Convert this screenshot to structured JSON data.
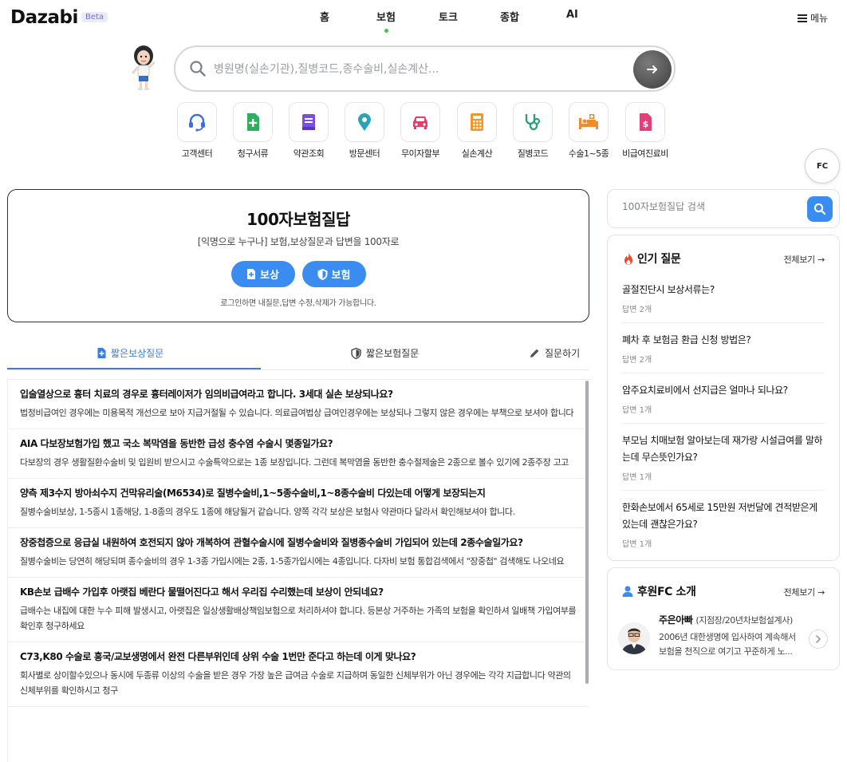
{
  "header": {
    "logo": "Dazabi",
    "badge": "Beta",
    "nav": [
      "홈",
      "보험",
      "토크",
      "종합",
      "AI"
    ],
    "active_nav": "보험",
    "menu_label": "메뉴"
  },
  "search": {
    "placeholder": "병원명(실손기관),질병코드,종수술비,실손계산..."
  },
  "quick_links": [
    {
      "label": "고객센터",
      "icon": "headset-icon",
      "color": "#3d6fe0"
    },
    {
      "label": "청구서류",
      "icon": "document-plus-icon",
      "color": "#2fae5e"
    },
    {
      "label": "약관조회",
      "icon": "book-icon",
      "color": "#7a4fe0"
    },
    {
      "label": "방문센터",
      "icon": "location-pin-icon",
      "color": "#2aa3b8"
    },
    {
      "label": "무이자할부",
      "icon": "car-icon",
      "color": "#e0406a"
    },
    {
      "label": "실손계산",
      "icon": "calculator-icon",
      "color": "#f0962a"
    },
    {
      "label": "질병코드",
      "icon": "stethoscope-icon",
      "color": "#2f9e7a"
    },
    {
      "label": "수술1~5종",
      "icon": "hospital-bed-icon",
      "color": "#f08a2a"
    },
    {
      "label": "비급여진료비",
      "icon": "price-document-icon",
      "color": "#e0407a"
    }
  ],
  "fc_button": "FC",
  "hero": {
    "title": "100자보험질답",
    "subtitle": "[익명으로 누구나] 보험,보상질문과 답변을 100자로",
    "button_claim": "보상",
    "button_insurance": "보험",
    "note": "로그인하면 내질문,답변 수정,삭제가 가능합니다."
  },
  "tabs": {
    "claim": "짧은보상질문",
    "insurance": "짧은보험질문",
    "ask": "질문하기"
  },
  "questions": [
    {
      "title": "입술열상으로 흉터 치료의 경우로 흉터레이저가 임의비급여라고 합니다. 3세대 실손 보상되나요?",
      "answer": "법정비급여인 경우에는 미용목적 개선으로 보아 지급거절될 수 있습니다. 의료급여법상 급여인경우에는 보상되나 그렇지 않은 경우에는 부책으로 보셔야 합니다"
    },
    {
      "title": "AIA 다보장보험가입 했고 국소 복막염을 동반한 급성 충수염 수술시 몇종일가요?",
      "answer": "다보장의 경우 생활질환수술비 및 입원비 받으시고 수술특약으로는 1종 보장입니다. 그런데 복막염을 동반한 충수절제술은 2종으로 볼수 있기에 2종주장 고고"
    },
    {
      "title": "양측 제3수지 방아쇠수지 건막유리술(M6534)로 질병수술비,1~5종수술비,1~8종수술비 다있는데 어떻게 보장되는지",
      "answer": "질병수술비보상, 1-5종시 1종해당, 1-8종의 경우도 1종에 해당될거 같습니다. 양쪽 각각 보상은 보험사 약관마다 달라서 확인해보셔야 합니다."
    },
    {
      "title": "장중첩증으로 응급실 내원하여 호전되지 않아 개복하여 관혈수술시에 질병수술비와 질병종수술비 가입되어 있는데 2종수술일가요?",
      "answer": "질병수술비는 당연히 해당되며 종수술비의 경우 1-3종 가입시에는 2종, 1-5종가입시에는 4종입니다. 다자비 보험 통합검색에서 \"장중첩\" 검색해도 나오네요"
    },
    {
      "title": "KB손보 급배수 가입후 아랫집 베란다 물떨어진다고 해서 우리집 수리했는데 보상이 안되네요?",
      "answer": "급배수는 내집에 대한 누수 피해 발생시고, 아랫집은 일상생활배상책임보험으로 처리하셔야 합니다. 등본상 거주하는 가족의 보험을 확인하셔 일배책 가입여부를 확인후 청구하세요"
    },
    {
      "title": "C73,K80 수술로 흥국/교보생명에서 완전 다른부위인데 상위 수술 1번만 준다고 하는데 이게 맞나요?",
      "answer": "회사별로 상이할수있으나 동시에 두종류 이상의 수술을 받은 경우 가장 높은 급여금 수술로 지급하며 동일한 신체부위가 아닌 경우에는 각각 지급합니다 약관의 신체부위를 확인하시고 청구"
    }
  ],
  "side_search": {
    "placeholder": "100자보험질답 검색"
  },
  "popular": {
    "title": "인기 질문",
    "more": "전체보기 →",
    "items": [
      {
        "q": "골절진단시 보상서류는?",
        "count": "답변 2개"
      },
      {
        "q": "폐차 후 보험금 환급 신청 방법은?",
        "count": "답변 2개"
      },
      {
        "q": "암주요치료비에서 선지급은 얼마나 되나요?",
        "count": "답변 1개"
      },
      {
        "q": "부모님 치매보험 알아보는데 재가랑 시설급여를 말하는데 무슨뜻인가요?",
        "count": "답변 1개"
      },
      {
        "q": "한화손보에서 65세로 15만원 저번달에 견적받은게 있는데 괜찮은가요?",
        "count": "답변 1개"
      }
    ]
  },
  "sponsor": {
    "title": "후원FC 소개",
    "more": "전체보기 →",
    "name": "주은아빠",
    "role": "(지점장/20년차보험설계사)",
    "desc": "2006년 대한생명에 입사하여 계속해서 보험을 천직으로 여기고 꾸준하게 노..."
  }
}
